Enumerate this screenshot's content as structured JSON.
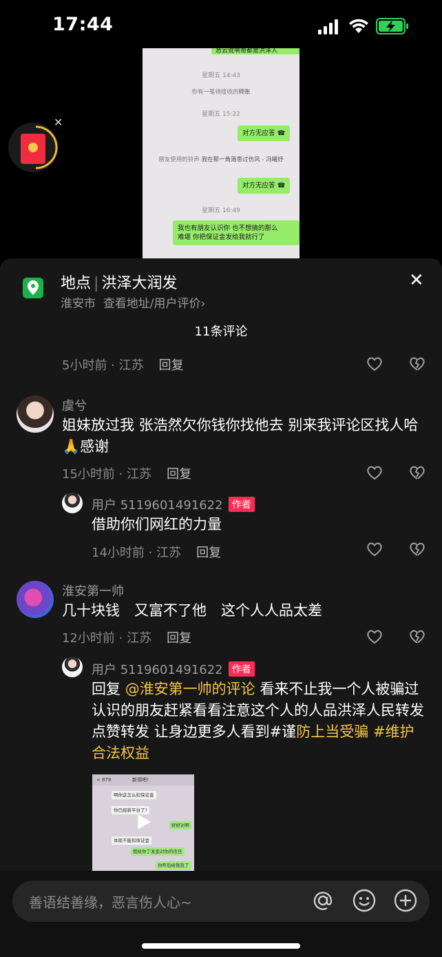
{
  "status_bar": {
    "time": "17:44"
  },
  "background_chat": {
    "partial_top": "恶云说啊哥都是洪泽人",
    "ts1": "星期五 14:43",
    "transfer_notice": "你有一笔待接收的",
    "transfer_word": "转账",
    "ts2": "星期五 15:22",
    "call1": "对方无应答",
    "ringtone_prefix": "朋友使用的铃声",
    "ringtone_song": "我在那一角落患过伤风 - 冯曦妤",
    "call2": "对方无应答",
    "ts3": "星期五 16:49",
    "msg_line1": "我也有朋友认识你 也不想搞的那么",
    "msg_line2": "难堪 你把保证金发给我就行了"
  },
  "location": {
    "label": "地点",
    "name": "洪泽大润发",
    "city": "淮安市",
    "link": "查看地址/用户评价",
    "chevron": "›",
    "close": "✕"
  },
  "comment_count": "11条评论",
  "comments": [
    {
      "meta": "5小时前 · 江苏",
      "reply": "回复"
    },
    {
      "user": "虞兮",
      "text": "姐妹放过我 张浩然欠你钱你找他去 别来我评论区找人哈🙏感谢",
      "meta": "15小时前 · 江苏",
      "reply": "回复",
      "sub_reply": {
        "user": "用户 5119601491622",
        "badge": "作者",
        "text": "借助你们网红的力量",
        "meta": "14小时前 · 江苏",
        "reply": "回复"
      }
    },
    {
      "user": "淮安第一帅",
      "text": "几十块钱　又富不了他　这个人人品太差",
      "meta": "12小时前 · 江苏",
      "reply": "回复",
      "sub_reply": {
        "user": "用户 5119601491622",
        "badge": "作者",
        "prefix": "回复 ",
        "mention": "@淮安第一帅的评论",
        "text": " 看来不止我一个人被骗过 认识的朋友赶紧看看注意这个人的人品洪泽人民转发点赞转发 让身边更多人看到#谨",
        "tag_highlight": "防上当受骗",
        "tag2": " #维护合法权益",
        "video": {
          "header": "新领吧!",
          "back": "< 879",
          "b1": "啊你这怎么扣保证金",
          "b2": "你已经新平台了?",
          "b3": "好好对啊",
          "b4": "体现不能扣保证金",
          "b5": "我给你丁发金对你的信任",
          "b6": "你昨后给我就了"
        }
      }
    }
  ],
  "input": {
    "placeholder": "善语结善缘，恶言伤人心~"
  },
  "colors": {
    "accent_red": "#fe2c55",
    "mention_yellow": "#f5c542",
    "location_green": "#1db14b"
  }
}
